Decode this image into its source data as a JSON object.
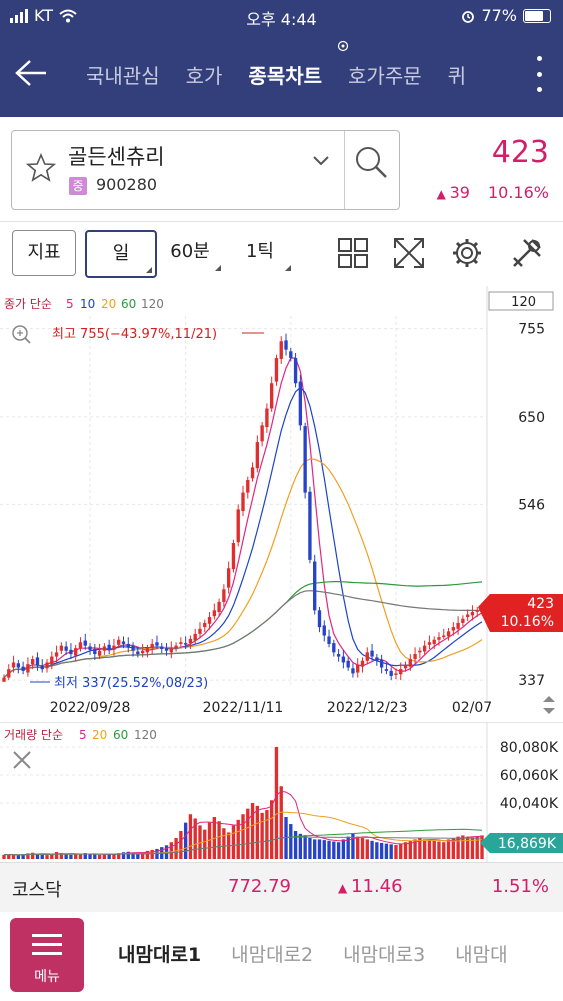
{
  "status": {
    "carrier": "KT",
    "time": "오후 4:44",
    "battery": "77%"
  },
  "nav": {
    "tabs": [
      {
        "label": "국내관심",
        "active": false
      },
      {
        "label": "호가",
        "active": false
      },
      {
        "label": "종목차트",
        "active": true
      },
      {
        "label": "호가주문",
        "active": false
      },
      {
        "label": "퀴",
        "active": false
      }
    ]
  },
  "stock": {
    "name": "골든센츄리",
    "badge": "중",
    "code": "900280",
    "price": "423",
    "change": "39",
    "change_pct": "10.16%"
  },
  "toolbar": {
    "indicator": "지표",
    "period": "일",
    "minute": "60분",
    "tick": "1틱"
  },
  "chart": {
    "legend_title": "종가 단순",
    "legend_periods": [
      {
        "label": "5",
        "color": "#e2247f"
      },
      {
        "label": "10",
        "color": "#1c43c6"
      },
      {
        "label": "20",
        "color": "#f0a020"
      },
      {
        "label": "60",
        "color": "#2c9a3a"
      },
      {
        "label": "120",
        "color": "#777777"
      }
    ],
    "period_box": "120",
    "high_label": "최고 755(−43.97%,11/21)",
    "low_label": "최저 337(25.52%,08/23)",
    "current_price": "423",
    "current_pct": "10.16%"
  },
  "volume": {
    "legend_title": "거래량 단순",
    "legend_periods": [
      {
        "label": "5",
        "color": "#e2247f"
      },
      {
        "label": "20",
        "color": "#f0a020"
      },
      {
        "label": "60",
        "color": "#2c9a3a"
      },
      {
        "label": "120",
        "color": "#777777"
      }
    ],
    "current": "16,869K"
  },
  "index": {
    "name": "코스닥",
    "value": "772.79",
    "change": "11.46",
    "pct": "1.51%"
  },
  "bottom": {
    "menu_label": "메뉴",
    "tabs": [
      "내맘대로1",
      "내맘대로2",
      "내맘대로3",
      "내맘대"
    ]
  },
  "colors": {
    "accent": "#333f7b",
    "up": "#e02d2d",
    "down": "#2743c8",
    "price": "#d41e6a"
  },
  "chart_data": [
    {
      "type": "candlestick",
      "x_ticks": [
        "2022/09/28",
        "2022/11/11",
        "2022/12/23",
        "02/07"
      ],
      "y_ticks": [
        755,
        650,
        546,
        337
      ],
      "ylim": [
        337,
        755
      ],
      "high": {
        "value": 755,
        "date": "11/21"
      },
      "low": {
        "value": 337,
        "date": "08/23"
      },
      "last": 423,
      "series_close": [
        340,
        350,
        358,
        352,
        348,
        356,
        362,
        355,
        350,
        358,
        365,
        370,
        378,
        372,
        368,
        375,
        382,
        378,
        373,
        368,
        372,
        377,
        374,
        378,
        385,
        380,
        376,
        372,
        368,
        372,
        375,
        380,
        378,
        374,
        372,
        375,
        378,
        382,
        380,
        386,
        392,
        398,
        405,
        412,
        420,
        430,
        445,
        470,
        500,
        540,
        560,
        575,
        590,
        620,
        640,
        660,
        690,
        720,
        740,
        730,
        720,
        690,
        640,
        560,
        480,
        420,
        400,
        390,
        380,
        370,
        365,
        358,
        352,
        345,
        355,
        360,
        370,
        365,
        360,
        352,
        348,
        342,
        345,
        350,
        355,
        362,
        368,
        372,
        378,
        382,
        385,
        388,
        390,
        395,
        400,
        405,
        410,
        415,
        418,
        420,
        423
      ],
      "x_labels": [],
      "ylabel": "",
      "xlabel": ""
    },
    {
      "type": "bar",
      "y_ticks": [
        "80,080K",
        "60,060K",
        "40,040K"
      ],
      "ylim": [
        0,
        80080
      ],
      "last_value": 16869,
      "values_k": [
        3000,
        3500,
        2800,
        2500,
        3200,
        4000,
        4500,
        3800,
        3000,
        2800,
        3600,
        5000,
        4200,
        3500,
        3000,
        3400,
        3800,
        4200,
        3600,
        3200,
        3000,
        3300,
        3600,
        3400,
        4200,
        4800,
        5200,
        4600,
        4000,
        4300,
        5800,
        6500,
        7200,
        8500,
        9800,
        12000,
        15000,
        20000,
        26000,
        32000,
        29000,
        24000,
        21000,
        26000,
        30000,
        27000,
        22000,
        19000,
        24000,
        28000,
        32000,
        36000,
        40000,
        38000,
        33000,
        35000,
        42000,
        80080,
        52000,
        30000,
        25000,
        20000,
        18000,
        17000,
        15000,
        14000,
        14000,
        13500,
        13000,
        12500,
        12000,
        14000,
        16000,
        18000,
        16000,
        15000,
        14000,
        13000,
        12000,
        11500,
        11000,
        10500,
        10000,
        11000,
        12000,
        13000,
        14000,
        15000,
        14000,
        13500,
        13000,
        12500,
        12000,
        14000,
        15000,
        16000,
        16869,
        16000,
        15500,
        16000,
        16869
      ]
    }
  ]
}
